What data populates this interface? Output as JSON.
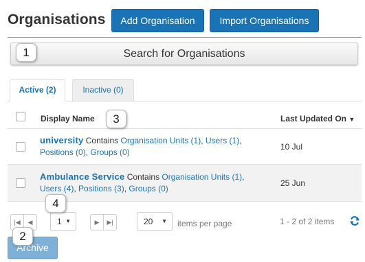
{
  "header": {
    "title": "Organisations",
    "add_button_label": "Add Organisation",
    "import_button_label": "Import Organisations"
  },
  "search": {
    "label": "Search for Organisations"
  },
  "tabs": [
    {
      "label": "Active (2)",
      "selected": true
    },
    {
      "label": "Inactive (0)",
      "selected": false
    }
  ],
  "grid": {
    "columns": {
      "name": "Display Name",
      "updated": "Last Updated On",
      "sort_indicator": "▼"
    },
    "rows": [
      {
        "name": "university",
        "contains_word": "Contains",
        "links": [
          "Organisation Units (1)",
          "Users (1)",
          "Positions (0)",
          "Groups (0)"
        ],
        "updated": "10 Jul"
      },
      {
        "name": "Ambulance Service",
        "contains_word": "Contains",
        "links": [
          "Organisation Units (1)",
          "Users (4)",
          "Positions (3)",
          "Groups (0)"
        ],
        "updated": "25 Jun"
      }
    ]
  },
  "pager": {
    "first_icon": "first-page-icon",
    "prev_icon": "previous-page-icon",
    "next_icon": "next-page-icon",
    "last_icon": "last-page-icon",
    "current_page": "1",
    "page_size": "20",
    "items_per_page_label": "items per page",
    "range_text": "1 - 2 of 2 items",
    "refresh_icon": "refresh-icon"
  },
  "archive_button_label": "Archive",
  "callouts": [
    "1",
    "2",
    "3",
    "4"
  ],
  "colors": {
    "accent": "#1a73b5",
    "archive_disabled": "#7fb0d8",
    "row_alt": "#f2f2f2"
  }
}
